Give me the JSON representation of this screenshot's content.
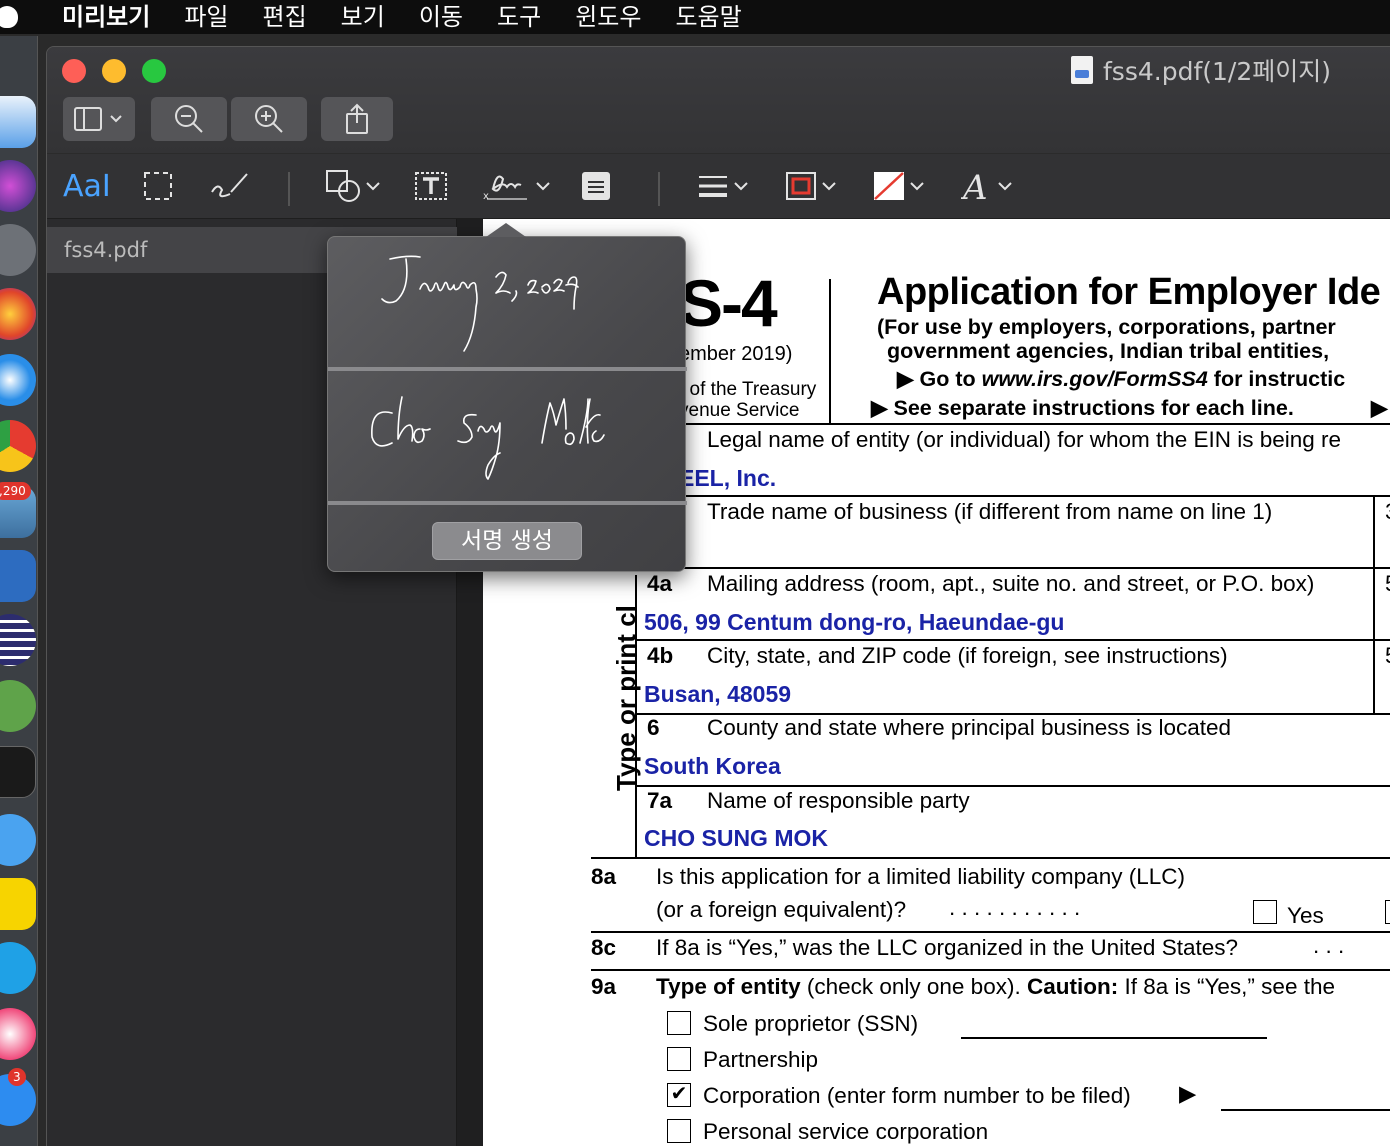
{
  "menubar": {
    "app": "미리보기",
    "items": [
      "파일",
      "편집",
      "보기",
      "이동",
      "도구",
      "윈도우",
      "도움말"
    ]
  },
  "dock": {
    "badges": {
      "mail": ",290",
      "appstore": "3"
    }
  },
  "window": {
    "title": "fss4.pdf(1/2페이지)"
  },
  "icons": {
    "sidebar_toggle": "sidebar-icon",
    "zoom_out": "zoom-out-icon",
    "zoom_in": "zoom-in-icon",
    "share": "share-icon",
    "text_select": "text-select-icon",
    "rect_select": "rect-select-icon",
    "sketch": "sketch-icon",
    "shapes": "shapes-icon",
    "text_box": "text-box-icon",
    "sign": "signature-icon",
    "note": "note-icon",
    "line_style": "line-style-icon",
    "border_color": "border-color-icon",
    "fill_color": "fill-color-icon",
    "text_style": "text-style-icon"
  },
  "markup": {
    "text_select_label": "AaI"
  },
  "sidebar": {
    "file": "fss4.pdf"
  },
  "popover": {
    "create_label": "서명 생성"
  },
  "colors": {
    "fill_text": "#1a23a6",
    "border_red": "#e53b30"
  },
  "form": {
    "number": "S-4",
    "date": "ember 2019)",
    "dept1": "t of the Treasury",
    "dept2": "venue Service",
    "title": "Application for Employer Ide",
    "subtitle": "(For use by employers, corporations, partner",
    "subtitle2": "government agencies, Indian tribal entities,",
    "goto_pre": "▶ Go to ",
    "goto_url": "www.irs.gov/FormSS4",
    "goto_post": " for instructic",
    "see_sep": "▶ See separate instructions for each line.",
    "see_arrow": "▶",
    "vertical": "Type or print cl",
    "line1_label": "Legal name of entity (or individual) for whom the EIN is being re",
    "line1_value": "EEL, Inc.",
    "line2_label": "Trade name of business (if different from name on line 1)",
    "line2_num_right": "3",
    "line4a_num": "4a",
    "line4a_label": "Mailing address (room, apt., suite no. and street, or P.O. box)",
    "line4a_value": "506, 99 Centum dong-ro, Haeundae-gu",
    "line4a_num_right": "5",
    "line4b_num": "4b",
    "line4b_label": "City, state, and ZIP code (if foreign, see instructions)",
    "line4b_value": "Busan, 48059",
    "line4b_num_right": "5",
    "line6_num": "6",
    "line6_label": "County and state where principal business is located",
    "line6_value": "South Korea",
    "line7a_num": "7a",
    "line7a_label": "Name of responsible party",
    "line7a_value": "CHO SUNG MOK",
    "line8a_num": "8a",
    "line8a_label": "Is this application for a limited liability company (LLC)",
    "line8a_label2": "(or a foreign equivalent)?",
    "line8a_dots": ".    .    .    .    .    .    .    .    .    .    .",
    "yes": "Yes",
    "line8c_num": "8c",
    "line8c_label": "If 8a is “Yes,” was the LLC organized in the United States?",
    "line8c_dots": ".    .    .",
    "line9a_num": "9a",
    "line9a_bold": "Type of entity",
    "line9a_mid": " (check only one box). ",
    "line9a_caution": "Caution:",
    "line9a_rest": " If 8a is “Yes,” see the",
    "opt_sole": "Sole proprietor (SSN)",
    "opt_partnership": "Partnership",
    "opt_corp": "Corporation (enter form number to be filed)",
    "opt_corp_arrow": "▶",
    "opt_psc": "Personal service corporation",
    "check_mark": "✔"
  }
}
